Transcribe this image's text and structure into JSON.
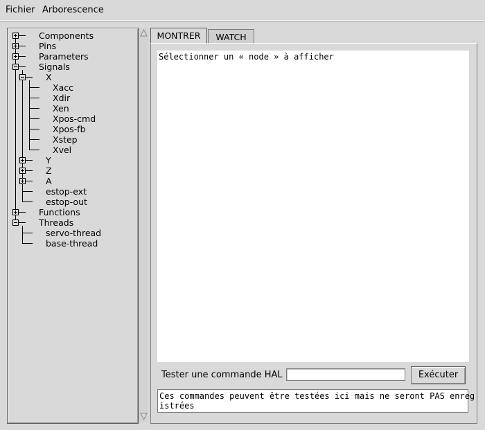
{
  "menu": {
    "file": "Fichier",
    "tree": "Arborescence"
  },
  "tree": {
    "components": "Components",
    "pins": "Pins",
    "parameters": "Parameters",
    "signals": "Signals",
    "x": "X",
    "xacc": "Xacc",
    "xdir": "Xdir",
    "xen": "Xen",
    "xpos_cmd": "Xpos-cmd",
    "xpos_fb": "Xpos-fb",
    "xstep": "Xstep",
    "xvel": "Xvel",
    "y": "Y",
    "z": "Z",
    "a": "A",
    "estop_ext": "estop-ext",
    "estop_out": "estop-out",
    "functions": "Functions",
    "threads": "Threads",
    "servo_thread": "servo-thread",
    "base_thread": "base-thread"
  },
  "tabs": {
    "show": "MONTRER",
    "watch": "WATCH"
  },
  "content": {
    "prompt": "Sélectionner un « node » à afficher"
  },
  "hal": {
    "label": "Tester une commande HAL :",
    "input_value": "",
    "execute": "Exécuter",
    "output_line1": "Ces commandes peuvent être testées ici mais ne seront PAS enreg",
    "output_line2": "istrées"
  }
}
